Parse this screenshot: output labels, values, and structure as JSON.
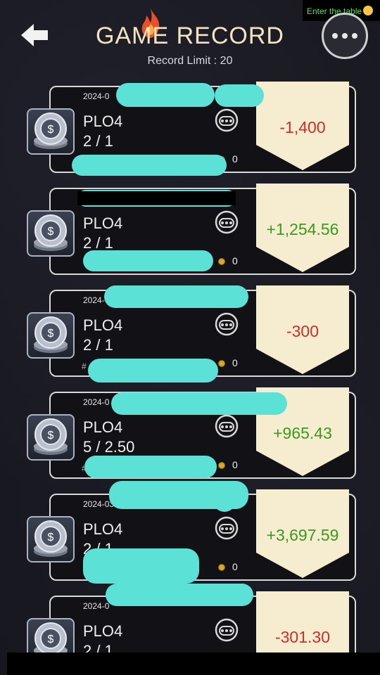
{
  "header": {
    "title": "GAME RECORD",
    "record_limit": "Record Limit : 20",
    "enter_table": "Enter the table"
  },
  "colors": {
    "negative": "#c8302a",
    "positive": "#3a9a1c",
    "title": "#f4e3c0",
    "tag": "#f6ecd0"
  },
  "records": [
    {
      "date": "2024-0",
      "game": "PLO4",
      "blinds": "2 / 1",
      "count": "0",
      "result": "-1,400",
      "sign": "neg"
    },
    {
      "date": "",
      "game": "PLO4",
      "blinds": "2 / 1",
      "count": "0",
      "result": "+1,254.56",
      "sign": "pos"
    },
    {
      "date": "2024-",
      "game": "PLO4",
      "blinds": "2 / 1",
      "hash": "#",
      "count": "0",
      "result": "-300",
      "sign": "neg"
    },
    {
      "date": "2024-0",
      "game": "PLO4",
      "blinds": "5 / 2.50",
      "hash": "#",
      "count": "0",
      "result": "+965.43",
      "sign": "pos"
    },
    {
      "date": "2024-03",
      "game": "PLO4",
      "blinds": "2 / 1",
      "hash": "",
      "count": "0",
      "result": "+3,697.59",
      "sign": "pos"
    },
    {
      "date": "2024-0",
      "game": "PLO4",
      "blinds": "2 / 1",
      "result": "-301.30",
      "sign": "neg"
    }
  ]
}
